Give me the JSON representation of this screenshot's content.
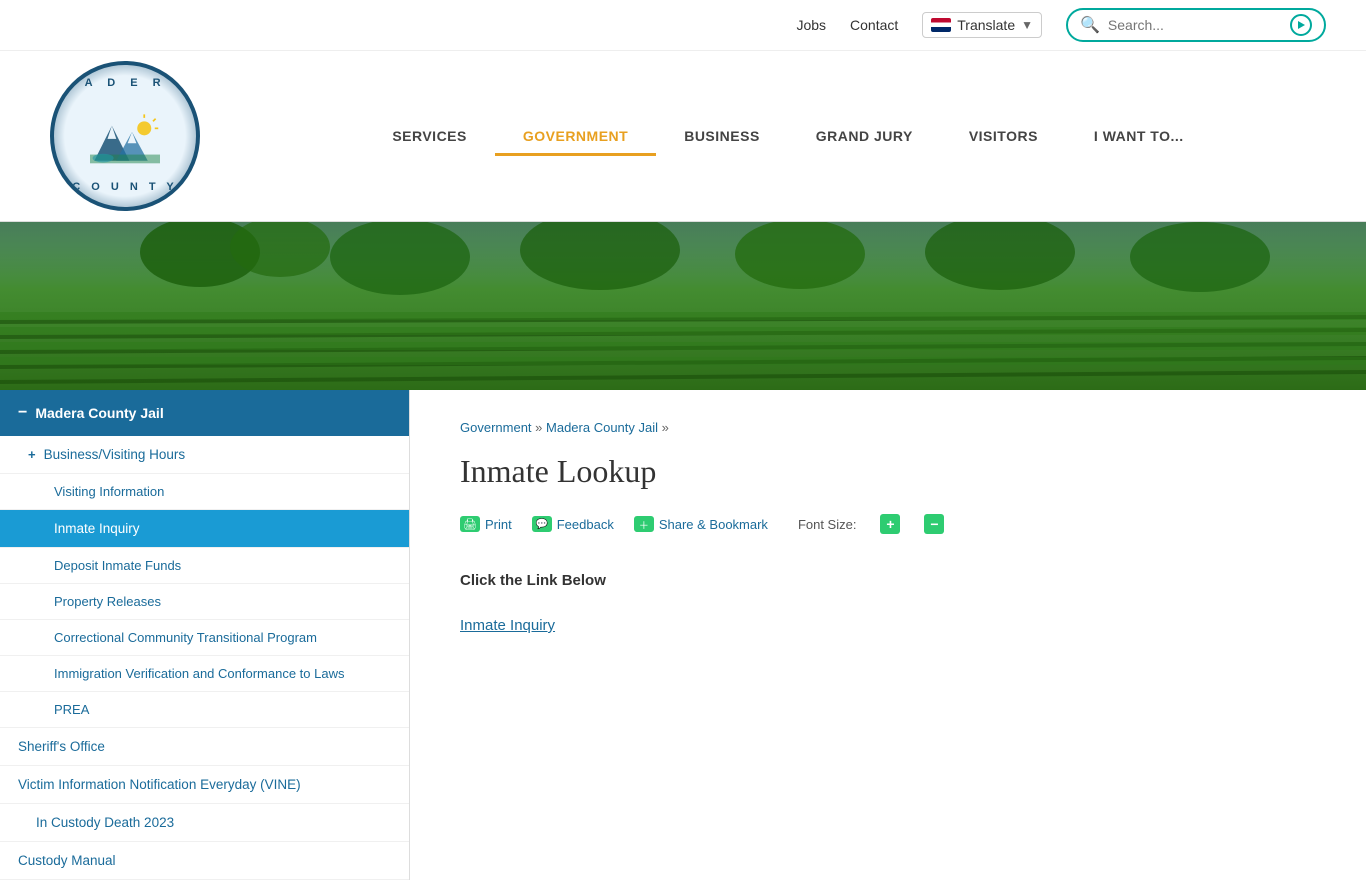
{
  "topbar": {
    "jobs_label": "Jobs",
    "contact_label": "Contact",
    "translate_label": "Translate",
    "search_placeholder": "Search..."
  },
  "nav": {
    "items": [
      {
        "label": "SERVICES",
        "active": false
      },
      {
        "label": "GOVERNMENT",
        "active": true
      },
      {
        "label": "BUSINESS",
        "active": false
      },
      {
        "label": "GRAND JURY",
        "active": false
      },
      {
        "label": "VISITORS",
        "active": false
      },
      {
        "label": "I WANT TO...",
        "active": false
      }
    ]
  },
  "sidebar": {
    "main_item": "Madera County Jail",
    "items": [
      {
        "label": "Business/Visiting Hours",
        "level": 1,
        "has_plus": true,
        "active": false
      },
      {
        "label": "Visiting Information",
        "level": 2,
        "active": false
      },
      {
        "label": "Inmate Inquiry",
        "level": 2,
        "active": true
      },
      {
        "label": "Deposit Inmate Funds",
        "level": 2,
        "active": false
      },
      {
        "label": "Property Releases",
        "level": 2,
        "active": false
      },
      {
        "label": "Correctional Community Transitional Program",
        "level": 2,
        "active": false
      },
      {
        "label": "Immigration Verification and Conformance to Laws",
        "level": 2,
        "active": false
      },
      {
        "label": "PREA",
        "level": 2,
        "active": false
      },
      {
        "label": "Sheriff's Office",
        "level": 1,
        "active": false
      },
      {
        "label": "Victim Information Notification Everyday (VINE)",
        "level": 1,
        "active": false
      },
      {
        "label": "In Custody Death 2023",
        "level": 1,
        "active": false
      },
      {
        "label": "Custody Manual",
        "level": 1,
        "active": false
      }
    ]
  },
  "breadcrumb": {
    "items": [
      {
        "label": "Government",
        "href": "#"
      },
      {
        "label": "Madera County Jail",
        "href": "#"
      }
    ]
  },
  "main": {
    "page_title": "Inmate Lookup",
    "toolbar": {
      "print_label": "Print",
      "feedback_label": "Feedback",
      "share_label": "Share & Bookmark",
      "font_size_label": "Font Size:"
    },
    "content": {
      "instruction_text": "Click the Link Below",
      "inmate_link_label": "Inmate Inquiry"
    }
  }
}
